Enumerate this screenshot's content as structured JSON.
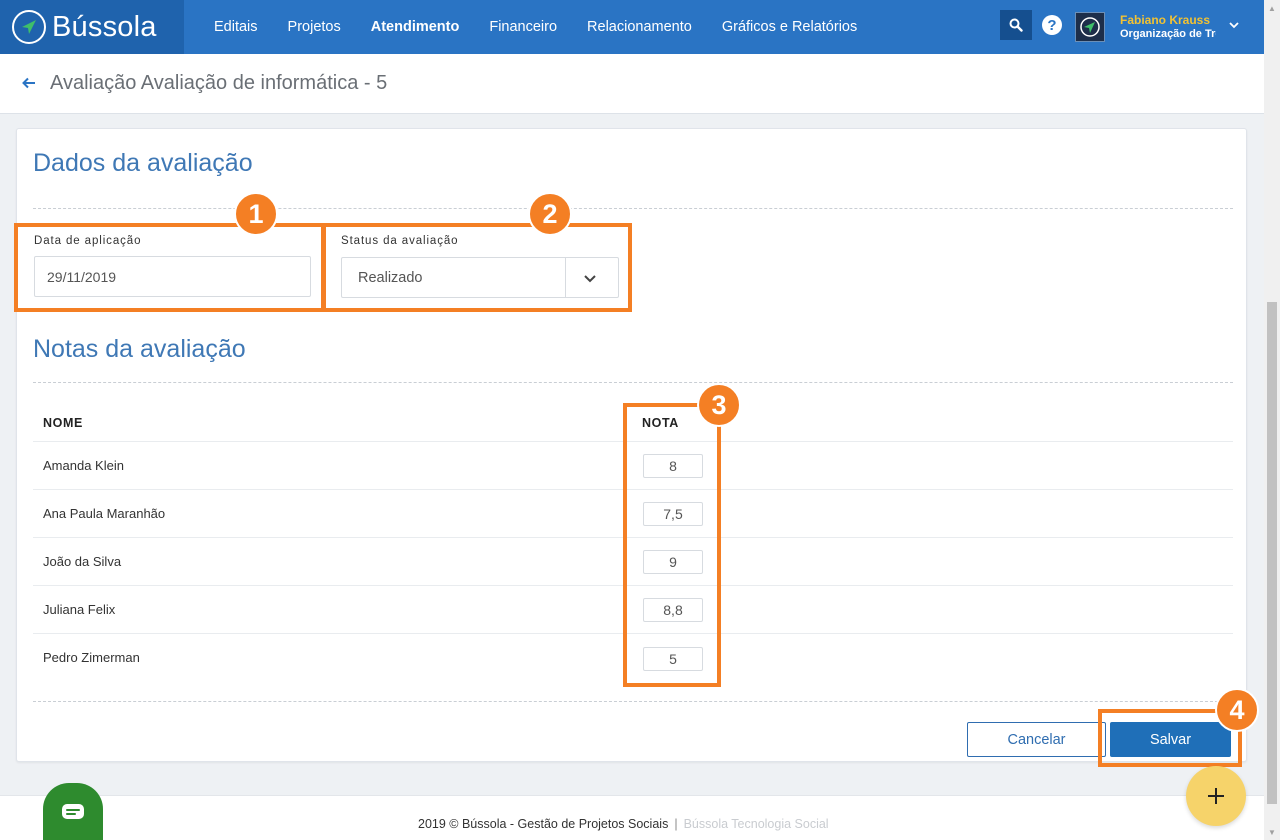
{
  "app": {
    "name": "Bússola"
  },
  "nav": {
    "items": [
      {
        "label": "Editais"
      },
      {
        "label": "Projetos"
      },
      {
        "label": "Atendimento",
        "active": true
      },
      {
        "label": "Financeiro"
      },
      {
        "label": "Relacionamento"
      },
      {
        "label": "Gráficos e Relatórios"
      }
    ]
  },
  "user": {
    "name": "Fabiano Krauss",
    "org": "Organização de Tre"
  },
  "page": {
    "title": "Avaliação Avaliação de informática - 5"
  },
  "dados": {
    "title": "Dados da avaliação",
    "date_label": "Data de aplicação",
    "date_value": "29/11/2019",
    "status_label": "Status da avaliação",
    "status_value": "Realizado"
  },
  "notas": {
    "title": "Notas da avaliação",
    "col_name": "NOME",
    "col_grade": "NOTA",
    "rows": [
      {
        "name": "Amanda Klein",
        "grade": "8"
      },
      {
        "name": "Ana Paula Maranhão",
        "grade": "7,5"
      },
      {
        "name": "João da Silva",
        "grade": "9"
      },
      {
        "name": "Juliana Felix",
        "grade": "8,8"
      },
      {
        "name": "Pedro Zimerman",
        "grade": "5"
      }
    ]
  },
  "actions": {
    "cancel": "Cancelar",
    "save": "Salvar"
  },
  "badges": [
    "1",
    "2",
    "3",
    "4"
  ],
  "footer": {
    "copyright": "2019 © Bússola - Gestão de Projetos Sociais",
    "separator": "|",
    "link": "Bússola Tecnologia Social"
  },
  "colors": {
    "primary": "#2a74c4",
    "primary_dark": "#1f63ad",
    "accent_orange": "#f47f24",
    "user_name": "#f2c233",
    "chat": "#2e8b2e",
    "fab": "#f6d36a"
  },
  "icons": {
    "logo": "compass-icon",
    "search": "search-icon",
    "help": "help-icon",
    "back": "arrow-left-icon",
    "dropdown": "chevron-down-icon",
    "chat": "chat-icon",
    "add": "plus-icon"
  }
}
